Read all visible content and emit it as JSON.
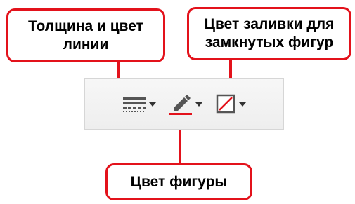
{
  "callouts": {
    "line_style": {
      "line1": "Толщина и цвет",
      "line2": "линии"
    },
    "fill_color": {
      "line1": "Цвет заливки для",
      "line2": "замкнутых фигур"
    },
    "shape_color": {
      "line1": "Цвет фигуры"
    }
  },
  "toolbar": {
    "line_style_icon": "line-style-icon",
    "shape_color_icon": "pencil-icon",
    "fill_color_icon": "fill-color-icon",
    "dropdown_icon": "chevron-down-icon"
  },
  "colors": {
    "accent": "#e3121b",
    "icon": "#555555",
    "toolbar_border": "#d6d6d6"
  }
}
